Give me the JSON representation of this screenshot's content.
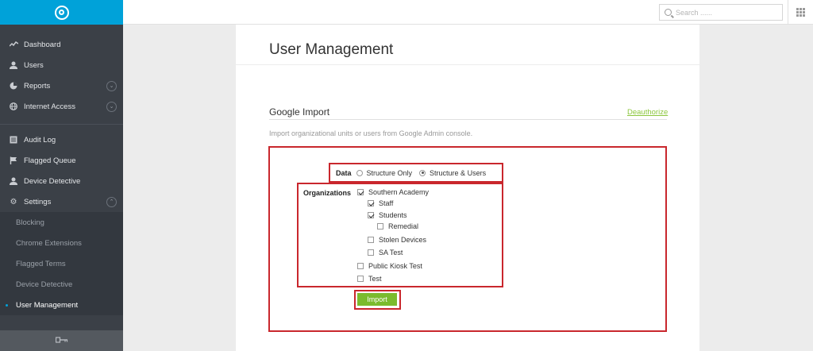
{
  "sidebar": {
    "logo_icon": "shield-target-icon",
    "main_items": [
      {
        "label": "Dashboard",
        "icon": "pulse-icon"
      },
      {
        "label": "Users",
        "icon": "user-icon"
      },
      {
        "label": "Reports",
        "icon": "pie-chart-icon"
      },
      {
        "label": "Internet Access",
        "icon": "globe-icon"
      }
    ],
    "secondary_items": [
      {
        "label": "Audit Log",
        "icon": "list-icon"
      },
      {
        "label": "Flagged Queue",
        "icon": "flag-icon"
      },
      {
        "label": "Device Detective",
        "icon": "user-icon"
      },
      {
        "label": "Settings",
        "icon": "gear-icon"
      }
    ],
    "settings_subitems": [
      {
        "label": "Blocking"
      },
      {
        "label": "Chrome Extensions"
      },
      {
        "label": "Flagged Terms"
      },
      {
        "label": "Device Detective"
      },
      {
        "label": "User Management",
        "active": true
      }
    ],
    "footer_icon": "key-icon"
  },
  "topbar": {
    "search_placeholder": "Search ......",
    "apps_icon": "grid-icon"
  },
  "page": {
    "title": "User Management",
    "section_title": "Google Import",
    "deauthorize_label": "Deauthorize",
    "description": "Import organizational units or users from Google Admin console.",
    "data_label": "Data",
    "data_options": [
      {
        "label": "Structure Only",
        "selected": false
      },
      {
        "label": "Structure & Users",
        "selected": true
      }
    ],
    "organizations_label": "Organizations",
    "organizations": [
      {
        "label": "Southern Academy",
        "checked": true
      },
      {
        "label": "Staff",
        "checked": true
      },
      {
        "label": "Students",
        "checked": true
      },
      {
        "label": "Remedial",
        "checked": false
      },
      {
        "label": "Stolen Devices",
        "checked": false
      },
      {
        "label": "SA Test",
        "checked": false
      },
      {
        "label": "Public Kiosk Test",
        "checked": false
      },
      {
        "label": "Test",
        "checked": false
      }
    ],
    "import_label": "Import"
  },
  "colors": {
    "accent": "#00a2d9",
    "sidebar_bg": "#3b4047",
    "highlight_border": "#c9272d",
    "button_green": "#7bbb2e",
    "link_green": "#8cc63e"
  }
}
